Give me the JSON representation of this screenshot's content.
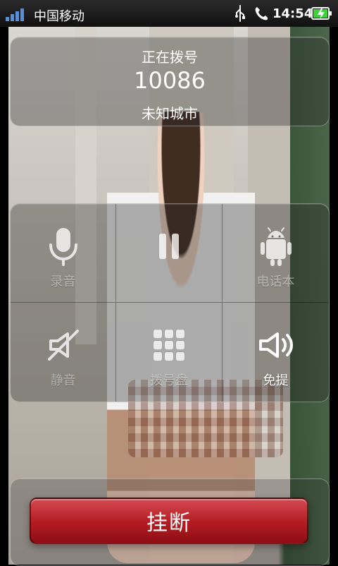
{
  "status_bar": {
    "carrier": "中国移动",
    "time": "14:54",
    "icons": {
      "signal": "signal-bars-icon",
      "usb": "usb-icon",
      "call": "phone-in-call-icon",
      "battery": "battery-charging-icon"
    },
    "colors": {
      "signal": "#5a8ed6",
      "battery": "#3bd23a"
    }
  },
  "call_info": {
    "status": "正在拨号",
    "number": "10086",
    "location": "未知城市"
  },
  "controls": {
    "items": [
      {
        "label": "录音",
        "icon": "microphone-icon",
        "active": false
      },
      {
        "label": "",
        "icon": "pause-icon",
        "active": false
      },
      {
        "label": "电话本",
        "icon": "android-icon",
        "active": false
      },
      {
        "label": "静音",
        "icon": "mute-icon",
        "active": false
      },
      {
        "label": "拨号盘",
        "icon": "keypad-icon",
        "active": false
      },
      {
        "label": "免提",
        "icon": "speaker-icon",
        "active": true
      }
    ]
  },
  "hangup": {
    "label": "挂断",
    "color": "#b31b22"
  }
}
